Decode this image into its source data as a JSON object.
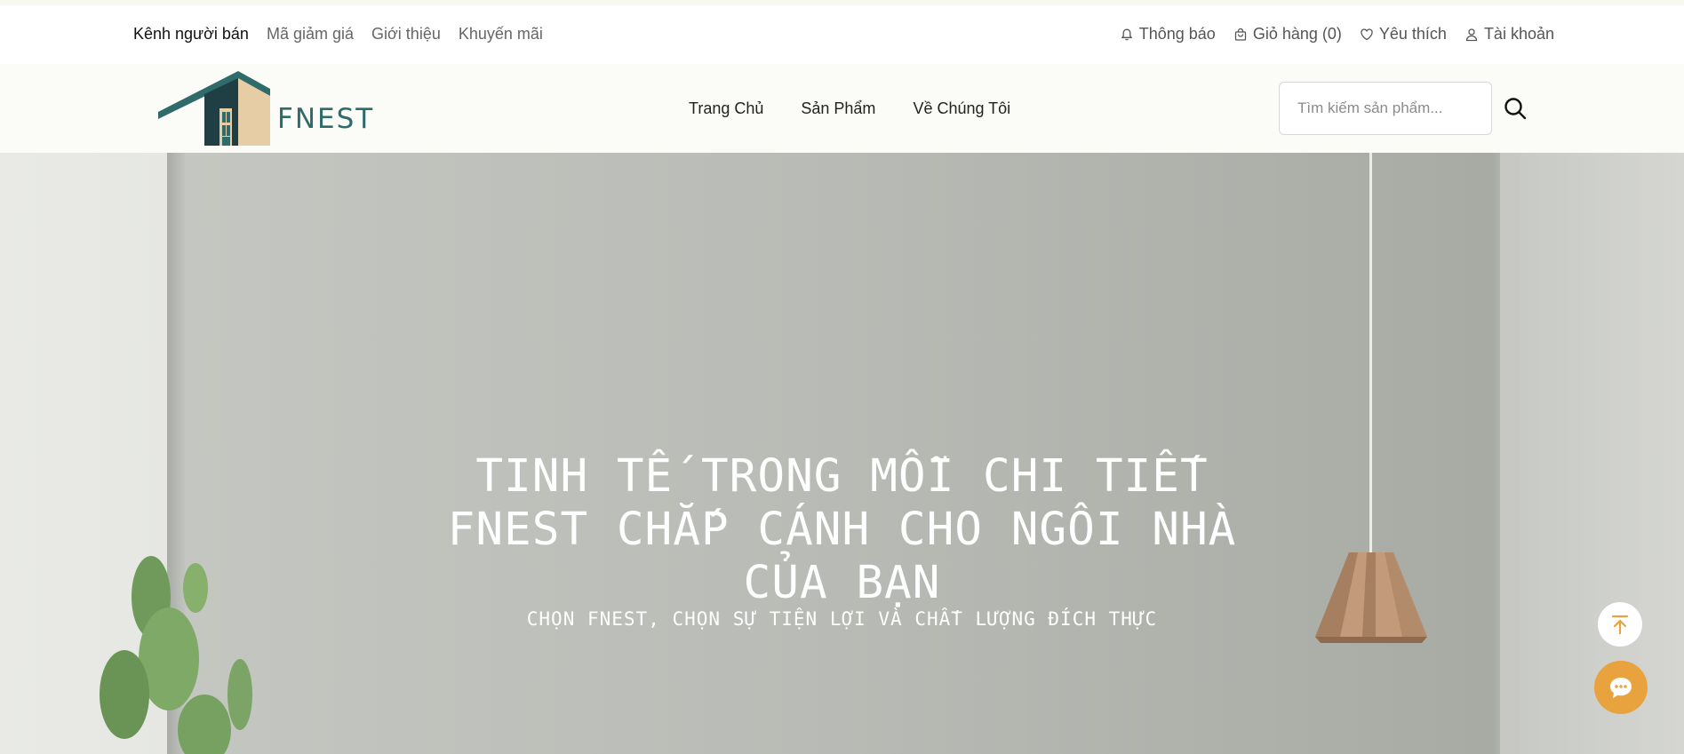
{
  "topbar": {
    "left_links": [
      {
        "label": "Kênh người bán"
      },
      {
        "label": "Mã giảm giá"
      },
      {
        "label": "Giới thiệu"
      },
      {
        "label": "Khuyến mãi"
      }
    ],
    "notifications_label": "Thông báo",
    "cart_label": "Giỏ hàng (0)",
    "wishlist_label": "Yêu thích",
    "account_label": "Tài khoản"
  },
  "header": {
    "logo_text": "FNEST",
    "nav": [
      {
        "label": "Trang Chủ"
      },
      {
        "label": "Sản Phẩm"
      },
      {
        "label": "Về Chúng Tôi"
      }
    ],
    "search_placeholder": "Tìm kiếm sản phẩm...",
    "search_value": ""
  },
  "hero": {
    "line1": "TINH TẾ TRONG MỖI CHI TIẾT",
    "line2": "FNEST CHẮP CÁNH CHO NGÔI NHÀ",
    "line3": "CỦA BẠN",
    "subtitle": "CHỌN FNEST, CHỌN SỰ TIỆN LỢI VÀ CHẤT LƯỢNG ĐÍCH THỰC"
  },
  "icons": {
    "notifications": "bell-icon",
    "cart": "shopping-bag-icon",
    "wishlist": "heart-icon",
    "account": "user-icon",
    "search": "search-icon",
    "back_to_top": "arrow-up-to-line-icon",
    "chat": "chat-bubble-icon"
  },
  "colors": {
    "brand_teal": "#2f6b6b",
    "brand_dark_teal": "#1f3f44",
    "brand_beige": "#e6cda6",
    "chat_orange": "#e8a33e"
  }
}
